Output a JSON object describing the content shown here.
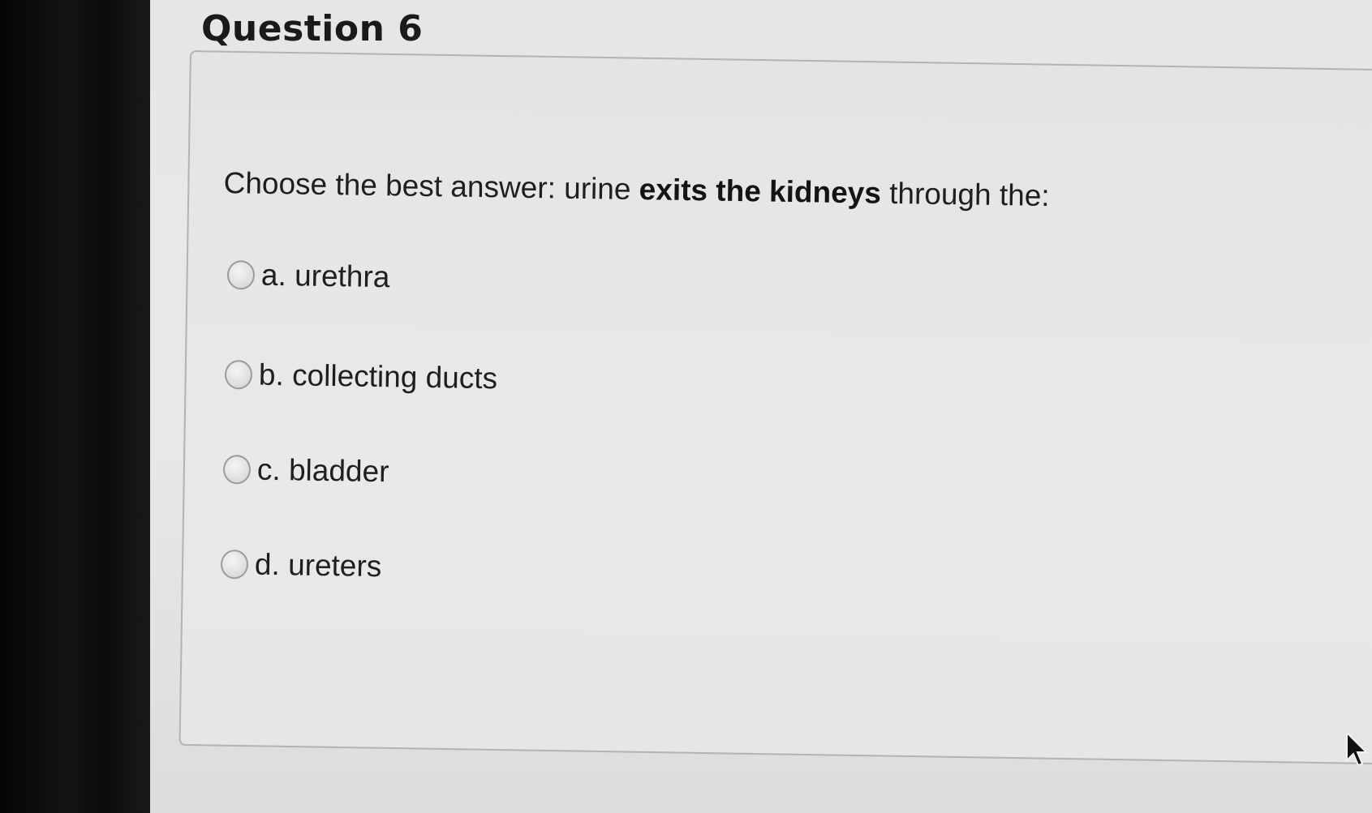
{
  "question": {
    "title": "Question 6",
    "prompt_prefix": "Choose the best answer: urine ",
    "prompt_bold": "exits the kidneys",
    "prompt_suffix": " through the:"
  },
  "options": [
    {
      "label": "a. urethra",
      "selected": false
    },
    {
      "label": "b. collecting ducts",
      "selected": false
    },
    {
      "label": "c. bladder",
      "selected": false
    },
    {
      "label": "d. ureters",
      "selected": false
    }
  ],
  "colors": {
    "screen_bg": "#e8e8e6",
    "card_border": "#b3b3b1",
    "text": "#1f1f1f",
    "bezel": "#0d0d0d"
  },
  "icons": {
    "pointer": "mouse-pointer-icon"
  }
}
